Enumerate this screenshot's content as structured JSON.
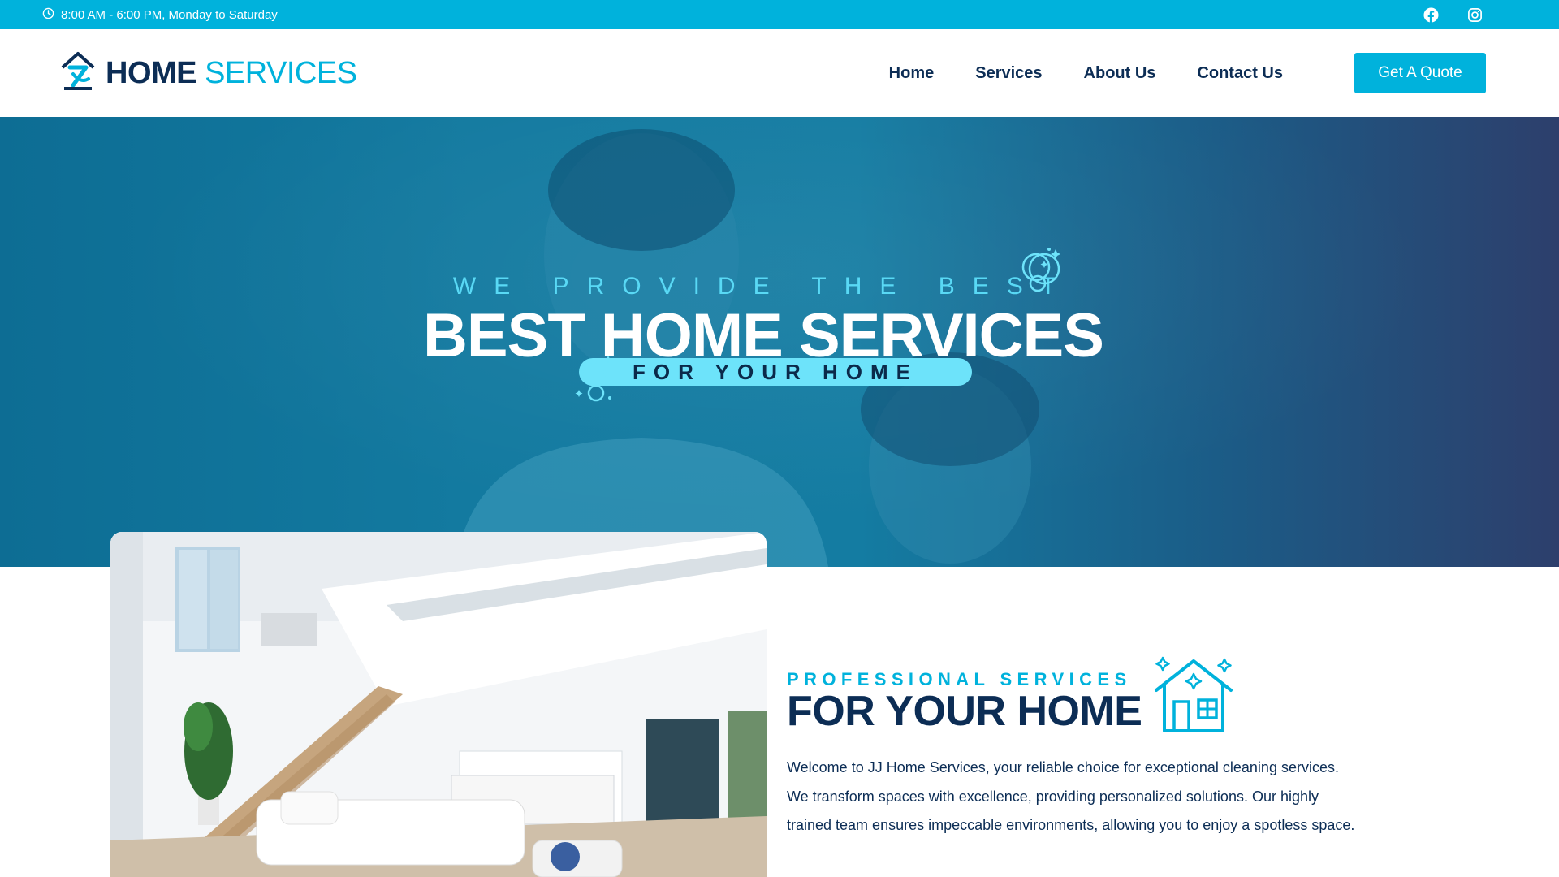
{
  "topbar": {
    "hours": "8:00 AM - 6:00 PM, Monday to Saturday",
    "icons": [
      "clock-icon",
      "facebook-icon",
      "instagram-icon"
    ]
  },
  "header": {
    "logo": {
      "word1": "HOME",
      "word2": "SERVICES"
    },
    "nav": [
      {
        "label": "Home"
      },
      {
        "label": "Services"
      },
      {
        "label": "About Us"
      },
      {
        "label": "Contact Us"
      }
    ],
    "cta": "Get A Quote"
  },
  "hero": {
    "subtitle": "WE PROVIDE THE BEST",
    "title": "BEST HOME SERVICES",
    "pill": "FOR YOUR HOME"
  },
  "about": {
    "kicker": "PROFESSIONAL SERVICES",
    "title": "FOR YOUR HOME",
    "body": "Welcome to JJ Home Services, your reliable choice for exceptional cleaning services. We transform spaces with excellence, providing personalized solutions. Our highly trained team ensures impeccable environments, allowing you to enjoy a spotless space."
  },
  "colors": {
    "accent": "#00b2dc",
    "navy": "#0c2d55",
    "pill": "#6de3fa"
  }
}
